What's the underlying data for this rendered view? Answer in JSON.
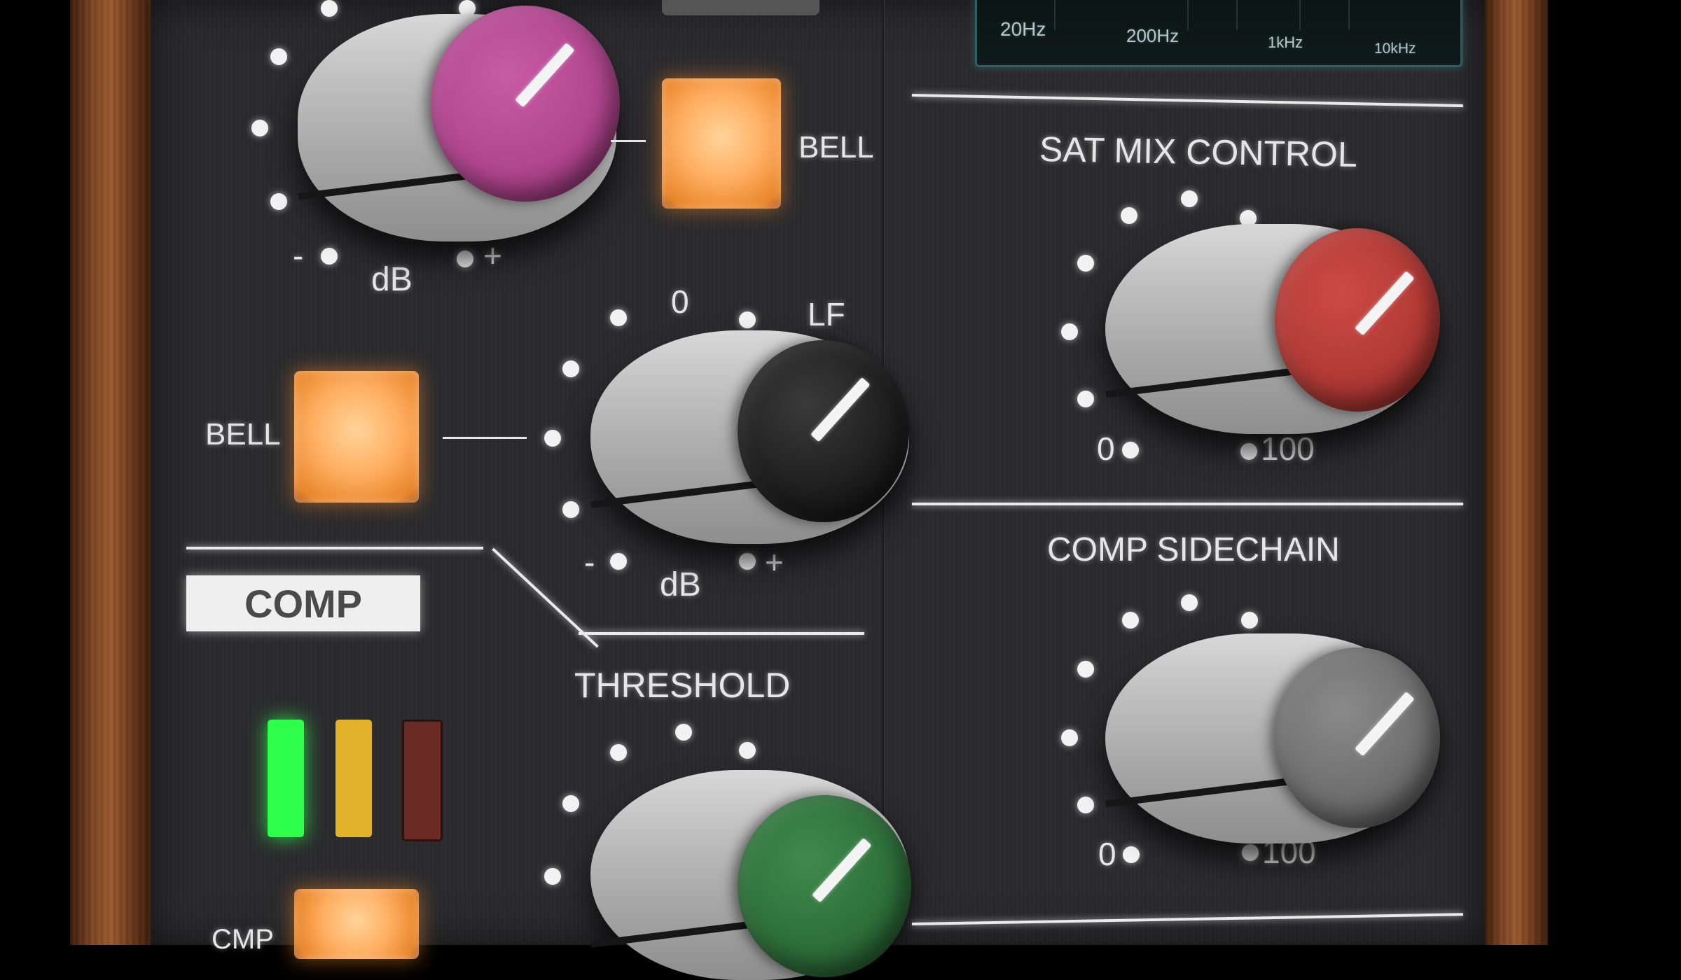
{
  "eq": {
    "top_band": {
      "gain_scale": "dB",
      "minus": "-",
      "plus": "+",
      "shape_button": "BELL",
      "cap_color": "#b2468f"
    },
    "lf_band": {
      "zero_mark": "0",
      "band_label": "LF",
      "gain_scale": "dB",
      "minus": "-",
      "plus": "+",
      "shape_button": "BELL",
      "cap_color": "#1c1c1c"
    }
  },
  "comp": {
    "section_label": "COMP",
    "threshold_label": "THRESHOLD",
    "threshold_cap_color": "#2e6f3a",
    "button_label_partial": "CMP",
    "meter_colors": [
      "#2dff4a",
      "#e1b22a",
      "#6b2a24"
    ]
  },
  "spectrum": {
    "freq_labels": [
      "20Hz",
      "200Hz",
      "1kHz",
      "10kHz"
    ]
  },
  "sat_mix": {
    "label": "SAT MIX CONTROL",
    "min": "0",
    "max": "100",
    "cap_color": "#b23a36"
  },
  "comp_sidechain": {
    "label": "COMP SIDECHAIN",
    "min": "0",
    "max": "100",
    "cap_color": "#6f6f6f"
  }
}
